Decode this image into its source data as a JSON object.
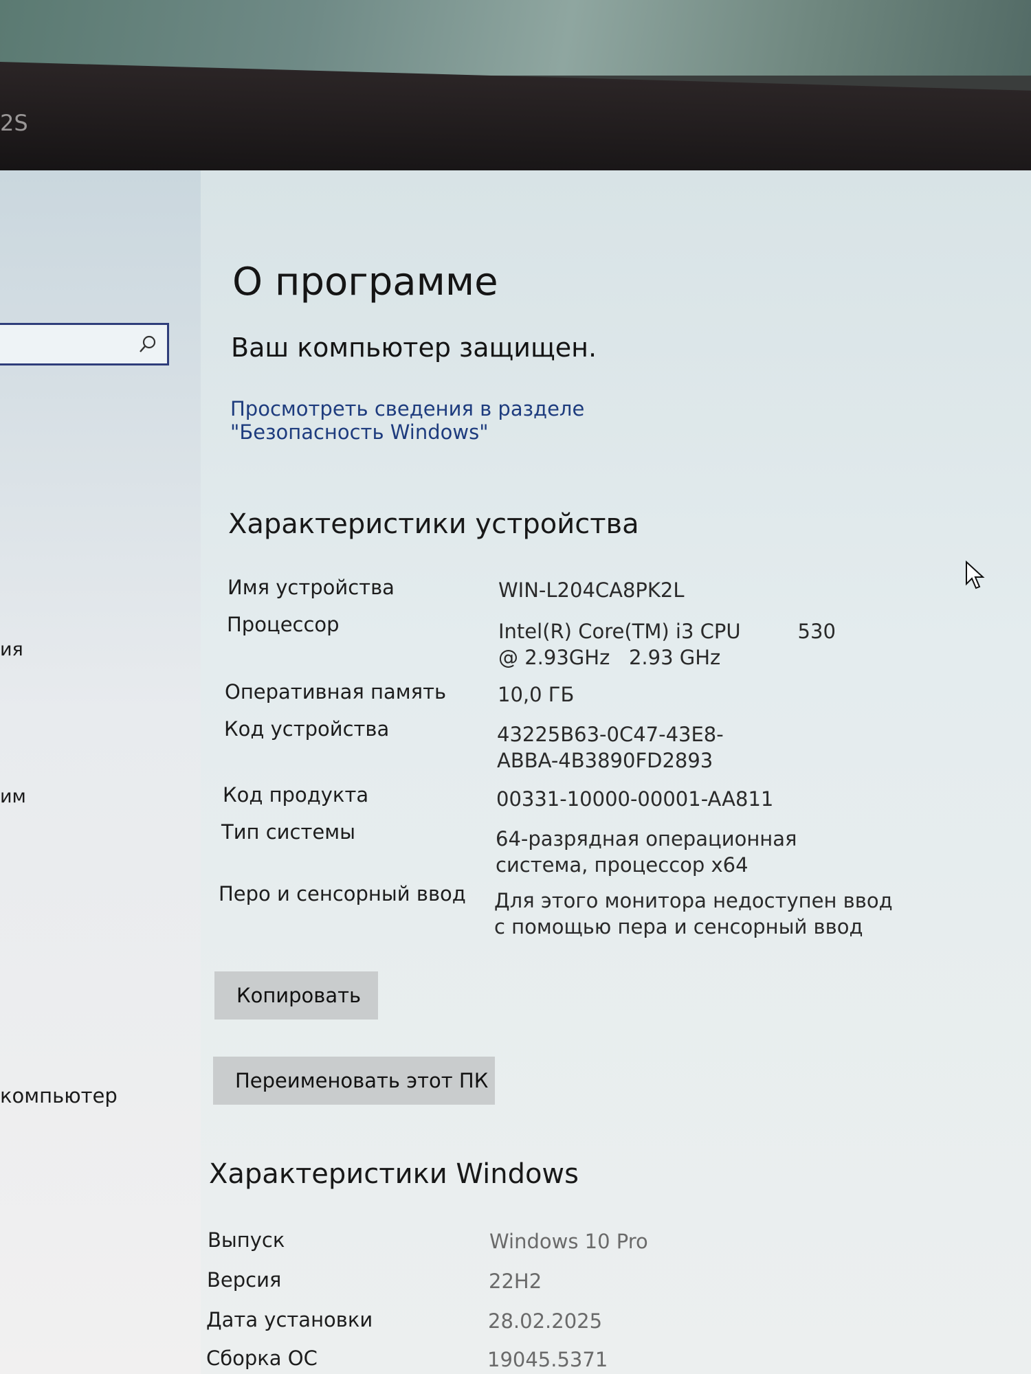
{
  "bezel": {
    "label": "2S"
  },
  "sidebar": {
    "search_placeholder": "",
    "fragments": [
      "ия",
      "им",
      "компьютер"
    ]
  },
  "main": {
    "title": "О программе",
    "protection_status": "Ваш компьютер защищен.",
    "security_link": "Просмотреть сведения в разделе \"Безопасность Windows\"",
    "device_specs": {
      "heading": "Характеристики устройства",
      "rows": [
        {
          "label": "Имя устройства",
          "value": "WIN-L204CA8PK2L"
        },
        {
          "label": "Процессор",
          "value": "Intel(R) Core(TM) i3 CPU         530  @ 2.93GHz   2.93 GHz"
        },
        {
          "label": "Оперативная память",
          "value": "10,0 ГБ"
        },
        {
          "label": "Код устройства",
          "value": "43225B63-0C47-43E8-ABBA-4B3890FD2893"
        },
        {
          "label": "Код продукта",
          "value": "00331-10000-00001-AA811"
        },
        {
          "label": "Тип системы",
          "value": "64-разрядная операционная система, процессор x64"
        },
        {
          "label": "Перо и сенсорный ввод",
          "value": "Для этого монитора недоступен ввод с помощью пера и сенсорный ввод"
        }
      ],
      "copy_button": "Копировать",
      "rename_button": "Переименовать этот ПК"
    },
    "windows_specs": {
      "heading": "Характеристики Windows",
      "rows": [
        {
          "label": "Выпуск",
          "value": "Windows 10 Pro"
        },
        {
          "label": "Версия",
          "value": "22H2"
        },
        {
          "label": "Дата установки",
          "value": "28.02.2025"
        },
        {
          "label": "Сборка ОС",
          "value": "19045.5371"
        }
      ]
    }
  },
  "colors": {
    "link": "#1e3c7e",
    "button_bg": "#c9cccd",
    "search_border": "#2f3d7a"
  },
  "icons": [
    "search-icon",
    "mouse-cursor-icon"
  ]
}
